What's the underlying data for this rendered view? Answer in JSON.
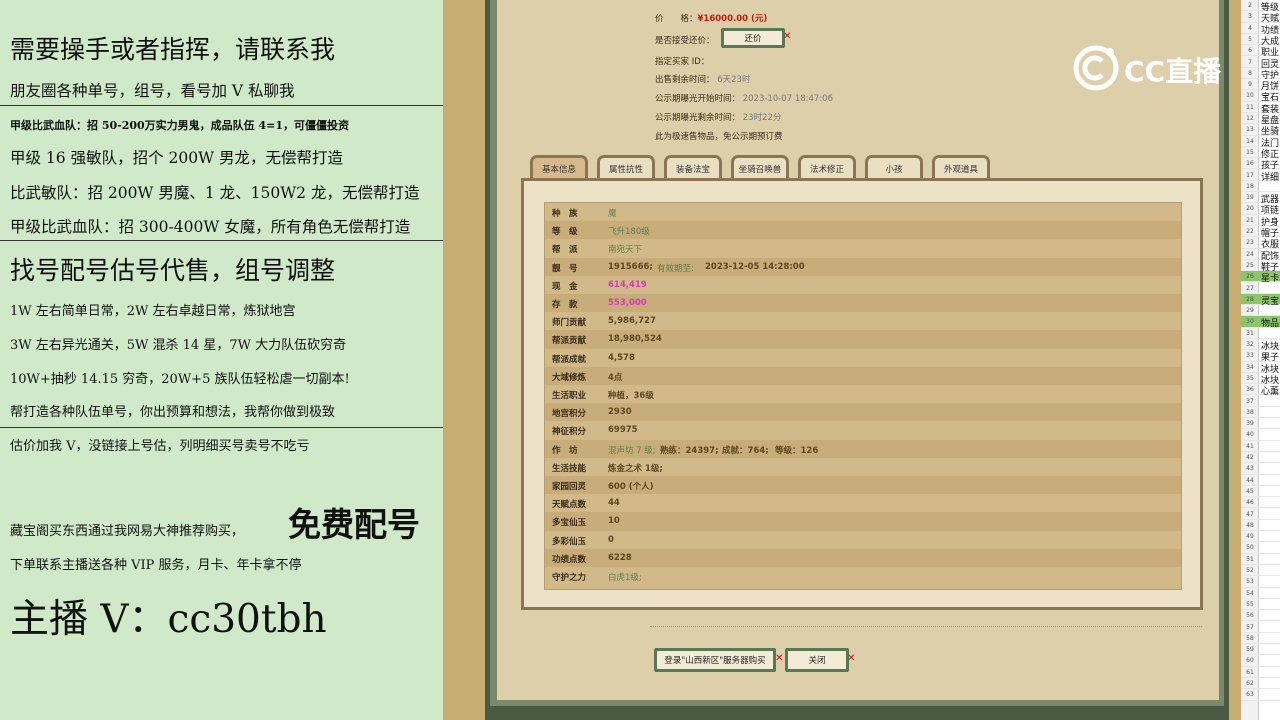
{
  "left_panel": {
    "line1": "需要操手或者指挥，请联系我",
    "line2": "朋友圈各种单号，组号，看号加 V 私聊我",
    "line3": "甲级比武血队：招 50-200万实力男鬼，成品队伍 4=1，可僵僵投资",
    "line4": "甲级 16 强敏队，招个 200W 男龙，无偿帮打造",
    "line5": "比武敏队：招 200W 男魔、1 龙、150W2 龙，无偿帮打造",
    "line6": "甲级比武血队：招 300-400W 女魔，所有角色无偿帮打造",
    "line7": "找号配号估号代售，组号调整",
    "line8": "1W 左右简单日常，2W 左右卓越日常，炼狱地宫",
    "line9": "3W 左右异光通关，5W 混杀 14 星，7W 大力队伍砍穷奇",
    "line10": "10W+抽秒 14.15 穷奇，20W+5 族队伍轻松虐一切副本!",
    "line11": "帮打造各种队伍单号，你出预算和想法，我帮你做到极致",
    "line12": "估价加我 V，没链接上号估，列明细买号卖号不吃亏",
    "line13a": "藏宝阁买东西通过我网易大神推荐购买，",
    "line13b": "免费配号",
    "line14": "下单联系主播送各种 VIP 服务，月卡、年卡拿不停",
    "line15": "主播 V：cc30tbh"
  },
  "info": {
    "price_label": "价　　格：",
    "price_value": "¥16000.00 (元)",
    "accept_label": "是否接受还价：",
    "counter_btn": "还价",
    "buyer_label": "指定买家 ID：",
    "remain_label": "出售剩余时间：",
    "remain_value": "6天23时",
    "pub_start_label": "公示期曝光开始时间：",
    "pub_start_value": "2023-10-07 18:47:06",
    "pub_remain_label": "公示期曝光剩余时间：",
    "pub_remain_value": "23时22分",
    "note": "此为极速售物品，免公示期预订费"
  },
  "tabs": [
    "基本信息",
    "属性抗性",
    "装备法宝",
    "坐骑召唤兽",
    "法术修正",
    "小孩",
    "外观道具"
  ],
  "rows": [
    {
      "label": "种　族",
      "value": "魔"
    },
    {
      "label": "等　级",
      "value": "飞升180级"
    },
    {
      "label": "帮　派",
      "value": "南宛天下"
    },
    {
      "label": "靓　号",
      "value": "1915666;",
      "extra1": "有效期至:",
      "extra2": "2023-12-05 14:28:00"
    },
    {
      "label": "现　金",
      "value": "614,419"
    },
    {
      "label": "存　款",
      "value": "553,000"
    },
    {
      "label": "师门贡献",
      "value": "5,986,727"
    },
    {
      "label": "帮派贡献",
      "value": "18,980,524"
    },
    {
      "label": "帮派成就",
      "value": "4,578"
    },
    {
      "label": "大域修炼",
      "value": "4点"
    },
    {
      "label": "生活职业",
      "value": "种植，36级"
    },
    {
      "label": "地宫积分",
      "value": "2930"
    },
    {
      "label": "神征积分",
      "value": "69975"
    },
    {
      "label": "作　坊",
      "value": "混声坊 7 级;",
      "extra1": "熟练：24397;",
      "extra2": "成就：764;",
      "extra3": "等级：126"
    },
    {
      "label": "生活技能",
      "value": "炼金之术 1级;"
    },
    {
      "label": "家园回灵",
      "value": "600 (个人)"
    },
    {
      "label": "天赋点数",
      "value": "44"
    },
    {
      "label": "多宝仙玉",
      "value": "10"
    },
    {
      "label": "多彩仙玉",
      "value": "0"
    },
    {
      "label": "功绩点数",
      "value": "6228"
    },
    {
      "label": "守护之力",
      "value": "白虎1级;"
    }
  ],
  "bottom": {
    "login_btn": "登录\"山西新区\"服务器购买",
    "close_btn": "关闭"
  },
  "logo": {
    "text": "CC直播"
  },
  "sheet": [
    {
      "n": "2",
      "t": "等级"
    },
    {
      "n": "3",
      "t": "天赋"
    },
    {
      "n": "4",
      "t": "功绩"
    },
    {
      "n": "5",
      "t": "大成"
    },
    {
      "n": "6",
      "t": "职业"
    },
    {
      "n": "7",
      "t": "回灵"
    },
    {
      "n": "8",
      "t": "守护"
    },
    {
      "n": "9",
      "t": "月饼"
    },
    {
      "n": "10",
      "t": "宝石"
    },
    {
      "n": "11",
      "t": "套装"
    },
    {
      "n": "12",
      "t": "星盘"
    },
    {
      "n": "13",
      "t": "坐骑"
    },
    {
      "n": "14",
      "t": "法门"
    },
    {
      "n": "15",
      "t": "修正"
    },
    {
      "n": "16",
      "t": "孩子"
    },
    {
      "n": "17",
      "t": "详细"
    },
    {
      "n": "18",
      "t": ""
    },
    {
      "n": "19",
      "t": "武器"
    },
    {
      "n": "20",
      "t": "项链"
    },
    {
      "n": "21",
      "t": "护身"
    },
    {
      "n": "22",
      "t": "帽子"
    },
    {
      "n": "23",
      "t": "衣服"
    },
    {
      "n": "24",
      "t": "配饰"
    },
    {
      "n": "25",
      "t": "鞋子"
    },
    {
      "n": "26",
      "t": "星卡"
    },
    {
      "n": "27",
      "t": ""
    },
    {
      "n": "28",
      "t": "灵宝"
    },
    {
      "n": "29",
      "t": ""
    },
    {
      "n": "30",
      "t": "物品"
    },
    {
      "n": "31",
      "t": ""
    },
    {
      "n": "32",
      "t": "冰块"
    },
    {
      "n": "33",
      "t": "果子"
    },
    {
      "n": "34",
      "t": "冰块"
    },
    {
      "n": "35",
      "t": "冰块"
    },
    {
      "n": "36",
      "t": "心薰"
    },
    {
      "n": "37",
      "t": ""
    },
    {
      "n": "38",
      "t": ""
    },
    {
      "n": "39",
      "t": ""
    },
    {
      "n": "40",
      "t": ""
    },
    {
      "n": "41",
      "t": ""
    },
    {
      "n": "42",
      "t": ""
    },
    {
      "n": "43",
      "t": ""
    },
    {
      "n": "44",
      "t": ""
    },
    {
      "n": "45",
      "t": ""
    },
    {
      "n": "46",
      "t": ""
    },
    {
      "n": "47",
      "t": ""
    },
    {
      "n": "48",
      "t": ""
    },
    {
      "n": "49",
      "t": ""
    },
    {
      "n": "50",
      "t": ""
    },
    {
      "n": "51",
      "t": ""
    },
    {
      "n": "52",
      "t": ""
    },
    {
      "n": "53",
      "t": ""
    },
    {
      "n": "54",
      "t": ""
    },
    {
      "n": "55",
      "t": ""
    },
    {
      "n": "56",
      "t": ""
    },
    {
      "n": "57",
      "t": ""
    },
    {
      "n": "58",
      "t": ""
    },
    {
      "n": "59",
      "t": ""
    },
    {
      "n": "60",
      "t": ""
    },
    {
      "n": "61",
      "t": ""
    },
    {
      "n": "62",
      "t": ""
    },
    {
      "n": "63",
      "t": ""
    }
  ],
  "colors": {
    "panel_bg": "#cfe9c9",
    "parchment": "#dccfa9",
    "frame_border": "#4a5a44",
    "price_red": "#c21a0e",
    "money_pink": "#d63ab6",
    "value_green": "#5a7f4d",
    "sheet_green": "#8cc66b"
  }
}
